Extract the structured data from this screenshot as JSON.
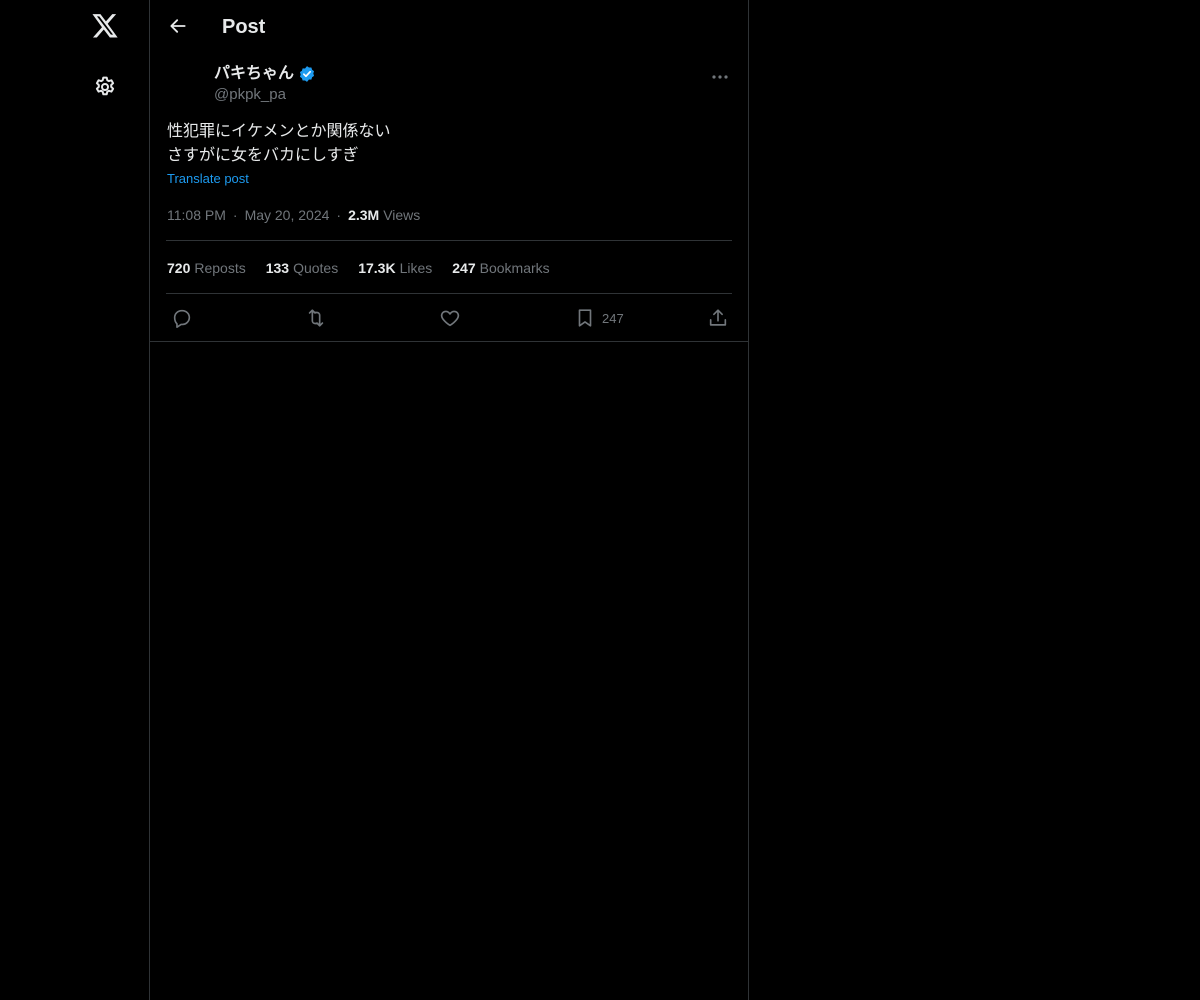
{
  "header": {
    "title": "Post"
  },
  "post": {
    "author": {
      "name": "パキちゃん",
      "handle": "@pkpk_pa",
      "verified": true
    },
    "text": "性犯罪にイケメンとか関係ない\nさすがに女をバカにしすぎ",
    "translate_label": "Translate post",
    "time": "11:08 PM",
    "date": "May 20, 2024",
    "views_count": "2.3M",
    "views_label": "Views",
    "stats": {
      "reposts": {
        "count": "720",
        "label": "Reposts"
      },
      "quotes": {
        "count": "133",
        "label": "Quotes"
      },
      "likes": {
        "count": "17.3K",
        "label": "Likes"
      },
      "bookmarks": {
        "count": "247",
        "label": "Bookmarks"
      }
    },
    "actions": {
      "bookmark_count": "247"
    }
  },
  "icons": {
    "logo": "x-logo-icon",
    "settings": "gear-icon",
    "back": "arrow-left-icon",
    "more": "more-horizontal-icon",
    "verified": "verified-badge-icon",
    "reply": "reply-icon",
    "repost": "repost-icon",
    "like": "heart-icon",
    "bookmark": "bookmark-icon",
    "share": "share-icon"
  },
  "colors": {
    "background": "#000000",
    "text_primary": "#e7e9ea",
    "text_secondary": "#71767b",
    "accent": "#1d9bf0",
    "border": "#2f3336"
  }
}
